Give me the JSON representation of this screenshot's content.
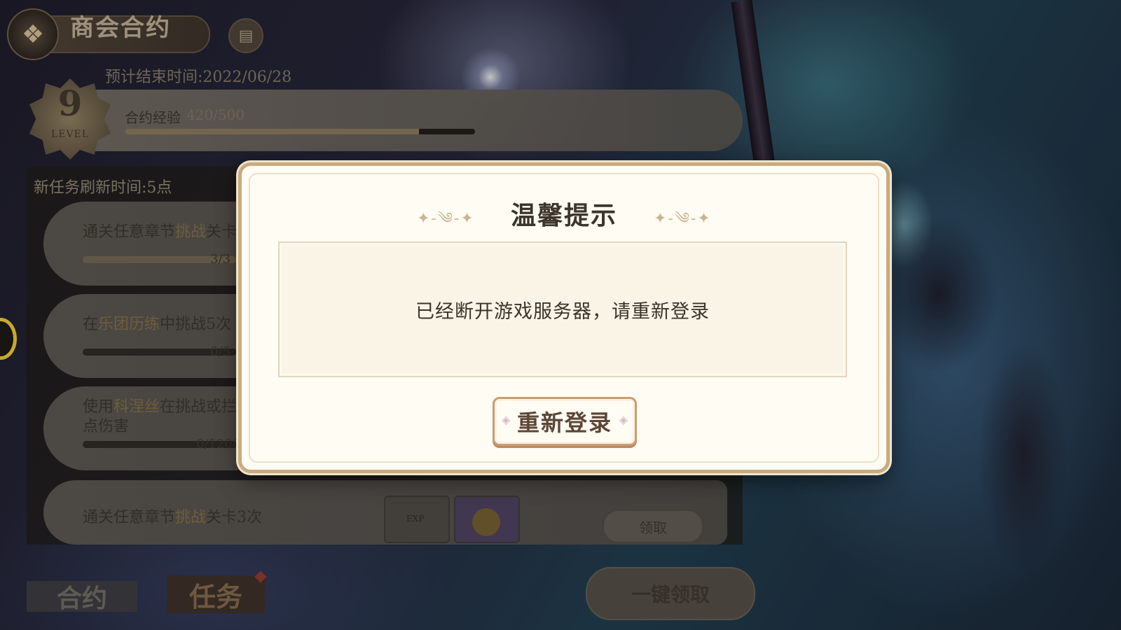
{
  "header": {
    "title": "商会合约",
    "end_time": "预计结束时间:2022/06/28"
  },
  "level": {
    "number": "9",
    "word": "LEVEL",
    "exp_label": "合约经验",
    "exp_value": "420/500",
    "exp_progress": 0.84
  },
  "tasks": {
    "refresh_text": "新任务刷新时间:5点",
    "items": [
      {
        "pre": "通关任意章节",
        "hl": "挑战",
        "post": "关卡",
        "count": "3/3",
        "progress": 1.0
      },
      {
        "pre": "在",
        "hl": "乐团历练",
        "post": "中挑战5次",
        "count": "0/5",
        "progress": 0.0
      },
      {
        "pre": "使用",
        "hl": "科涅丝",
        "post": "在挑战或拦",
        "line2": "点伤害",
        "count": "0/12000",
        "progress": 0.0
      },
      {
        "pre": "通关任意章节",
        "hl": "挑战",
        "post": "关卡3次",
        "claim": "领取"
      }
    ],
    "reward_exp_label": "EXP"
  },
  "bottom": {
    "tab_contract": "合约",
    "tab_task": "任务",
    "claim_all": "一键领取"
  },
  "dialog": {
    "title": "温馨提示",
    "message": "已经断开游戏服务器，请重新登录",
    "button": "重新登录"
  },
  "colors": {
    "dialog_bg": "#fefcf3",
    "dialog_border": "#c9ab7f",
    "button_border": "#c99d73"
  }
}
